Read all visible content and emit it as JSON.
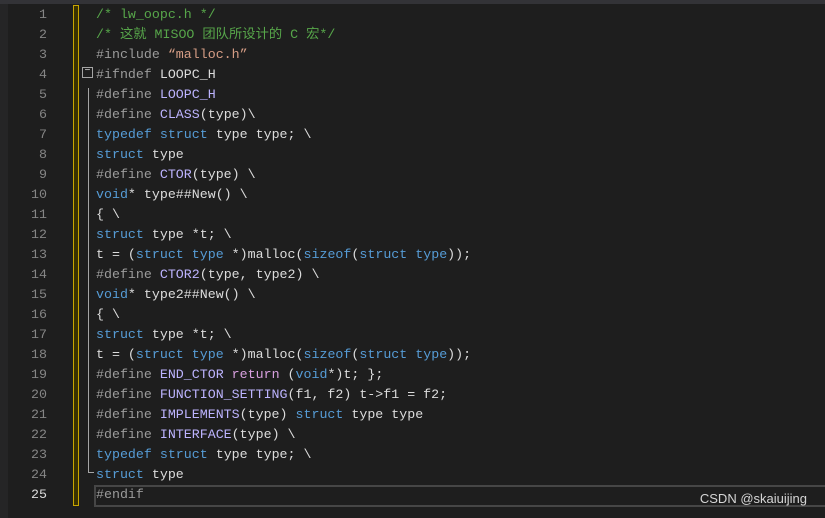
{
  "editor": {
    "current_line": 25,
    "lines": [
      [
        [
          "cm",
          "/* lw_oopc.h */"
        ]
      ],
      [
        [
          "cm",
          "/* 这就 MISOO 团队所设计的 C 宏*/"
        ]
      ],
      [
        [
          "pp",
          "#include "
        ],
        [
          "st",
          "“malloc.h”"
        ]
      ],
      [
        [
          "pp",
          "#ifndef "
        ],
        [
          "tx",
          "LOOPC_H"
        ]
      ],
      [
        [
          "pp",
          "#define "
        ],
        [
          "mc",
          "LOOPC_H"
        ]
      ],
      [
        [
          "pp",
          "#define "
        ],
        [
          "mc",
          "CLASS"
        ],
        [
          "tx",
          "(type)\\"
        ]
      ],
      [
        [
          "kw",
          "typedef"
        ],
        [
          "tx",
          " "
        ],
        [
          "kw",
          "struct"
        ],
        [
          "tx",
          " type type; \\"
        ]
      ],
      [
        [
          "kw",
          "struct"
        ],
        [
          "tx",
          " type"
        ]
      ],
      [
        [
          "pp",
          "#define "
        ],
        [
          "mc",
          "CTOR"
        ],
        [
          "tx",
          "(type) \\"
        ]
      ],
      [
        [
          "kw",
          "void"
        ],
        [
          "tx",
          "* type##New() \\"
        ]
      ],
      [
        [
          "tx",
          "{ \\"
        ]
      ],
      [
        [
          "kw",
          "struct"
        ],
        [
          "tx",
          " type *t; \\"
        ]
      ],
      [
        [
          "tx",
          "t = ("
        ],
        [
          "kw",
          "struct"
        ],
        [
          "tx",
          " "
        ],
        [
          "kw",
          "type"
        ],
        [
          "tx",
          " *)malloc("
        ],
        [
          "kw",
          "sizeof"
        ],
        [
          "tx",
          "("
        ],
        [
          "kw",
          "struct"
        ],
        [
          "tx",
          " "
        ],
        [
          "kw",
          "type"
        ],
        [
          "tx",
          "));"
        ]
      ],
      [
        [
          "pp",
          "#define "
        ],
        [
          "mc",
          "CTOR2"
        ],
        [
          "tx",
          "(type, type2) \\"
        ]
      ],
      [
        [
          "kw",
          "void"
        ],
        [
          "tx",
          "* type2##New() \\"
        ]
      ],
      [
        [
          "tx",
          "{ \\"
        ]
      ],
      [
        [
          "kw",
          "struct"
        ],
        [
          "tx",
          " type *t; \\"
        ]
      ],
      [
        [
          "tx",
          "t = ("
        ],
        [
          "kw",
          "struct"
        ],
        [
          "tx",
          " "
        ],
        [
          "kw",
          "type"
        ],
        [
          "tx",
          " *)malloc("
        ],
        [
          "kw",
          "sizeof"
        ],
        [
          "tx",
          "("
        ],
        [
          "kw",
          "struct"
        ],
        [
          "tx",
          " "
        ],
        [
          "kw",
          "type"
        ],
        [
          "tx",
          "));"
        ]
      ],
      [
        [
          "pp",
          "#define "
        ],
        [
          "mc",
          "END_CTOR"
        ],
        [
          "tx",
          " "
        ],
        [
          "rt",
          "return"
        ],
        [
          "tx",
          " ("
        ],
        [
          "kw",
          "void"
        ],
        [
          "tx",
          "*)t; };"
        ]
      ],
      [
        [
          "pp",
          "#define "
        ],
        [
          "mc",
          "FUNCTION_SETTING"
        ],
        [
          "tx",
          "(f1, f2) t->f1 = f2;"
        ]
      ],
      [
        [
          "pp",
          "#define "
        ],
        [
          "mc",
          "IMPLEMENTS"
        ],
        [
          "tx",
          "(type) "
        ],
        [
          "kw",
          "struct"
        ],
        [
          "tx",
          " type type"
        ]
      ],
      [
        [
          "pp",
          "#define "
        ],
        [
          "mc",
          "INTERFACE"
        ],
        [
          "tx",
          "(type) \\"
        ]
      ],
      [
        [
          "kw",
          "typedef"
        ],
        [
          "tx",
          " "
        ],
        [
          "kw",
          "struct"
        ],
        [
          "tx",
          " type type; \\"
        ]
      ],
      [
        [
          "kw",
          "struct"
        ],
        [
          "tx",
          " type"
        ]
      ],
      [
        [
          "pp",
          "#endif"
        ]
      ]
    ],
    "fold_toggle": "−"
  },
  "watermark": "CSDN @skaiuijing"
}
